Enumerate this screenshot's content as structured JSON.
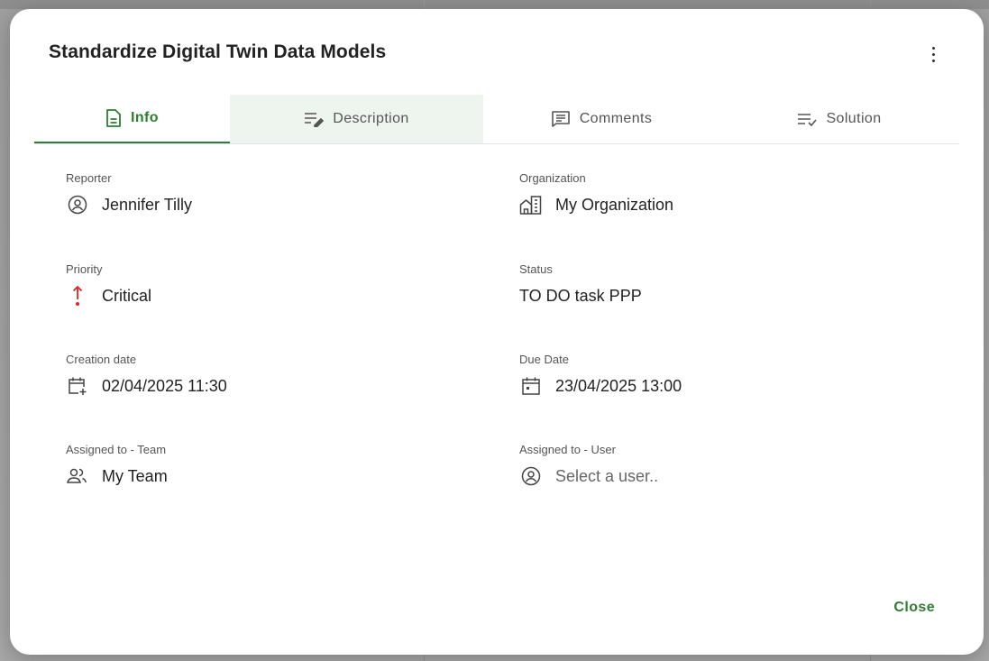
{
  "dialog": {
    "title": "Standardize Digital Twin Data Models",
    "close_label": "Close"
  },
  "tabs": [
    {
      "label": "Info",
      "icon": "file-text-icon",
      "active": true
    },
    {
      "label": "Description",
      "icon": "edit-lines-icon"
    },
    {
      "label": "Comments",
      "icon": "comment-icon"
    },
    {
      "label": "Solution",
      "icon": "list-check-icon"
    }
  ],
  "fields": {
    "reporter": {
      "label": "Reporter",
      "value": "Jennifer Tilly",
      "icon": "user-circle-icon"
    },
    "organization": {
      "label": "Organization",
      "value": "My Organization",
      "icon": "building-icon"
    },
    "priority": {
      "label": "Priority",
      "value": "Critical",
      "icon": "priority-up-icon",
      "color": "#e02424"
    },
    "status": {
      "label": "Status",
      "value": "TO DO task PPP"
    },
    "creation_date": {
      "label": "Creation date",
      "value": "02/04/2025 11:30",
      "icon": "calendar-add-icon"
    },
    "due_date": {
      "label": "Due Date",
      "value": "23/04/2025 13:00",
      "icon": "calendar-event-icon"
    },
    "team": {
      "label": "Assigned to - Team",
      "value": "My Team",
      "icon": "team-icon"
    },
    "user": {
      "label": "Assigned to - User",
      "placeholder": "Select a user..",
      "icon": "user-circle-icon"
    }
  },
  "colors": {
    "accent": "#2e7d32",
    "active_tab_bg": "#eef5ef",
    "critical": "#e02424"
  }
}
